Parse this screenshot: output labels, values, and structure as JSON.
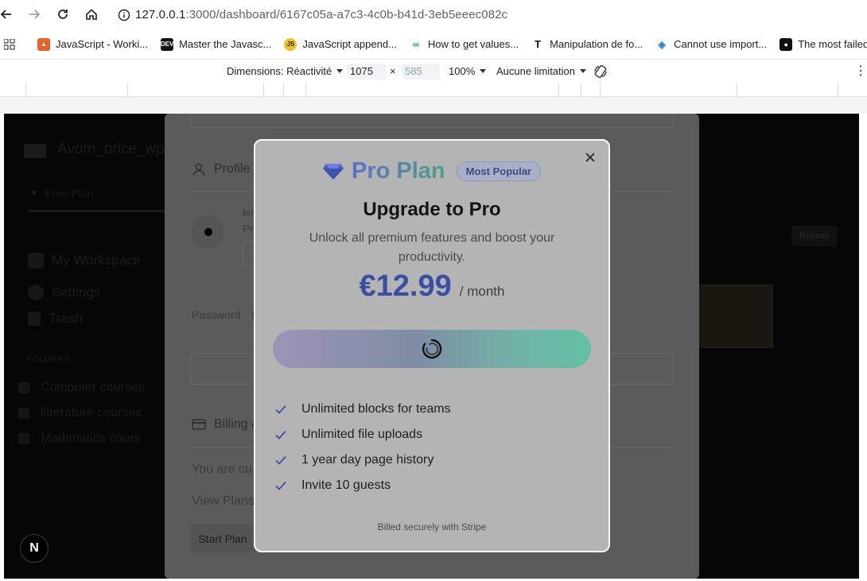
{
  "browser": {
    "url_host": "127.0.0.1",
    "url_rest": ":3000/dashboard/6167c05a-a7c3-4c0b-b41d-3eb5eeec082c",
    "bookmarks": [
      {
        "label": "JavaScript - Worki...",
        "icon": "fire-icon",
        "color": "#e8612a"
      },
      {
        "label": "Master the Javasc...",
        "icon": "dev-icon",
        "color": "#111111"
      },
      {
        "label": "JavaScript append...",
        "icon": "js-icon",
        "color": "#f2c21b"
      },
      {
        "label": "How to get values...",
        "icon": "link-icon",
        "color": "#23a35a"
      },
      {
        "label": "Manipulation de fo...",
        "icon": "t-icon",
        "color": "#111111"
      },
      {
        "label": "Cannot use import...",
        "icon": "stack-icon",
        "color": "#2f7fd8"
      },
      {
        "label": "The most failed J",
        "icon": "video-icon",
        "color": "#111111"
      }
    ]
  },
  "devtools": {
    "dimensions_label": "Dimensions: Réactivité",
    "width": "1075",
    "times": "×",
    "height": "585",
    "zoom": "100%",
    "throttle": "Aucune limitation"
  },
  "app": {
    "workspace_name": "Avom_brice_wp",
    "plan": "Free Plan",
    "nav": [
      {
        "label": "My Workspace"
      },
      {
        "label": "Settings"
      },
      {
        "label": "Trash"
      }
    ],
    "folders_label": "FOLDERS",
    "folders": [
      {
        "label": "Computer courses"
      },
      {
        "label": "litterature courses"
      },
      {
        "label": "Mathmatics cours"
      }
    ],
    "refresh_label": "Refresh"
  },
  "settings": {
    "profile_label": "Profile",
    "user_short": "bri",
    "user_plan_short": "Pr",
    "password_label": "Password",
    "password_rest": "F",
    "billing_label": "Billing &",
    "you_are_text": "You are cu",
    "view_plans": "View Plans",
    "start_plan": "Start Plan"
  },
  "modal": {
    "plan_name": "Pro Plan",
    "badge": "Most Popular",
    "heading": "Upgrade to Pro",
    "subtitle": "Unlock all premium features and boost your productivity.",
    "price": "€12.99",
    "period": "/ month",
    "features": [
      "Unlimited blocks for teams",
      "Unlimited file uploads",
      "1 year day page history",
      "Invite 10 guests"
    ],
    "footer": "Billed securely with Stripe",
    "accent": "#3a4fa3"
  },
  "next_badge": "N"
}
